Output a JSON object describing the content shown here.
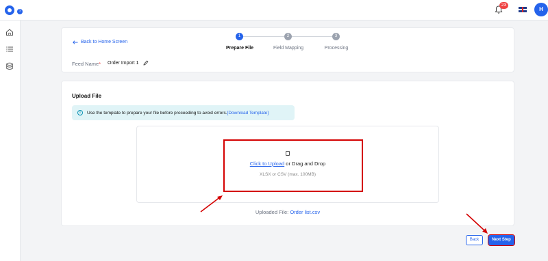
{
  "topbar": {
    "notification_count": "23",
    "avatar_initial": "H",
    "language_flag": "uk-flag-icon"
  },
  "sidebar": {
    "items": [
      {
        "icon": "home-icon"
      },
      {
        "icon": "list-icon"
      },
      {
        "icon": "database-icon"
      }
    ]
  },
  "header": {
    "back_label": "Back to Home Screen",
    "feed_name_label": "Feed Name",
    "feed_name_required": "*",
    "feed_name_value": "Order Import 1",
    "steps": [
      {
        "number": "1",
        "label": "Prepare File",
        "active": true
      },
      {
        "number": "2",
        "label": "Field Mapping",
        "active": false
      },
      {
        "number": "3",
        "label": "Processing",
        "active": false
      }
    ]
  },
  "upload": {
    "title": "Upload File",
    "info_text": "Use the template to prepare your file before proceeding to avoid errors.",
    "download_template_label": "[Download Template]",
    "click_to_upload": "Click to Upload",
    "drag_drop_text": " or Drag and Drop",
    "formats": "XLSX or CSV (max. 100MB)",
    "uploaded_label": "Uploaded File: ",
    "uploaded_file": "Order list.csv"
  },
  "actions": {
    "back_label": "Back",
    "next_label": "Next Step"
  },
  "colors": {
    "accent": "#2563eb",
    "highlight": "#d40000",
    "badge": "#ef4444",
    "info_bg": "#e0f4f7"
  }
}
